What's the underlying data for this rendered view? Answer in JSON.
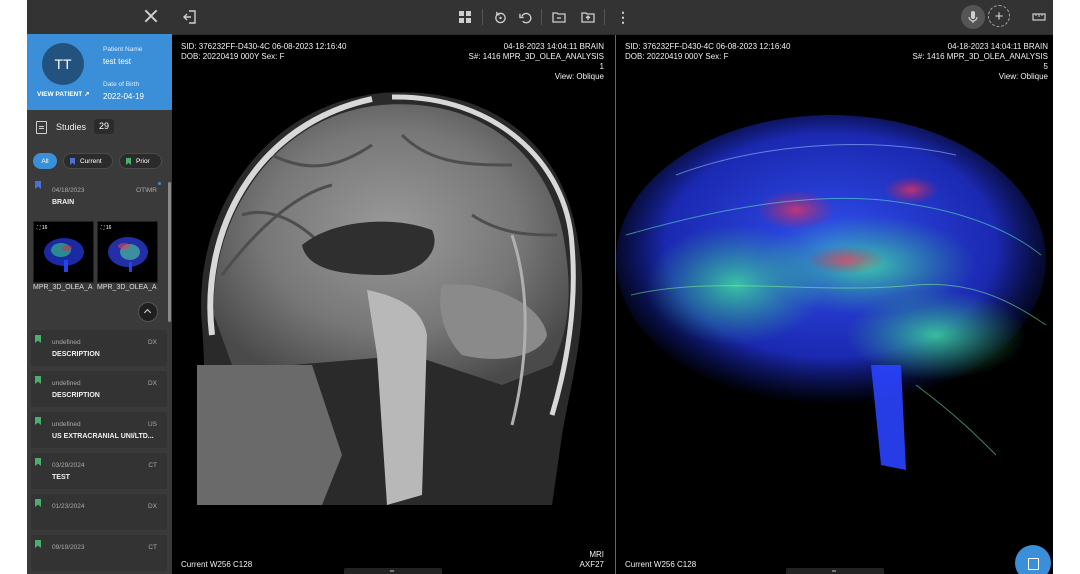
{
  "patient": {
    "initials": "TT",
    "view_patient": "VIEW PATIENT",
    "name_label": "Patient Name",
    "name": "test test",
    "dob_label": "Date of Birth",
    "dob": "2022-04-19"
  },
  "studies": {
    "label": "Studies",
    "count": "29",
    "filters": [
      "All",
      "Current",
      "Prior"
    ],
    "active_filter": "All",
    "expanded": {
      "date": "04/18/2023",
      "modality": "OT\\MR",
      "description": "BRAIN",
      "thumbnails": [
        {
          "label": "MPR_3D_OLEA_A",
          "badge": "16"
        },
        {
          "label": "MPR_3D_OLEA_A",
          "badge": "16"
        }
      ]
    },
    "items": [
      {
        "date": "undefined",
        "modality": "DX",
        "description": "DESCRIPTION"
      },
      {
        "date": "undefined",
        "modality": "DX",
        "description": "DESCRIPTION"
      },
      {
        "date": "undefined",
        "modality": "US",
        "description": "US EXTRACRANIAL UNI/LTD..."
      },
      {
        "date": "03/29/2024",
        "modality": "CT",
        "description": "TEST"
      },
      {
        "date": "01/23/2024",
        "modality": "DX",
        "description": ""
      },
      {
        "date": "09/19/2023",
        "modality": "CT",
        "description": ""
      }
    ]
  },
  "toolbar": {
    "icons": [
      "exit-icon",
      "layout-grid-icon",
      "reset-icon",
      "undo-icon",
      "folder-icon",
      "folder-export-icon",
      "more-vertical-icon",
      "microphone-icon",
      "add-icon",
      "ruler-icon"
    ]
  },
  "viewports": [
    {
      "sid": "SID: 376232FF-D430-4C  06-08-2023 12:16:40",
      "dob": "DOB: 20220419  000Y  Sex: F",
      "study_time": "04-18-2023 14:04:11  BRAIN",
      "series": "S#: 1416  MPR_3D_OLEA_ANALYSIS",
      "image_number": "1",
      "view": "View: Oblique",
      "wl": "Current  W256 C128",
      "modality": "MRI",
      "code": "AXF27"
    },
    {
      "sid": "SID: 376232FF-D430-4C  06-08-2023 12:16:40",
      "dob": "DOB: 20220419  000Y  Sex: F",
      "study_time": "04-18-2023 14:04:11  BRAIN",
      "series": "S#: 1416  MPR_3D_OLEA_ANALYSIS",
      "image_number": "5",
      "view": "View: Oblique",
      "wl": "Current  W256 C128"
    }
  ],
  "colors": {
    "accent": "#3a8fd8",
    "current_bookmark": "#4c6fd8",
    "prior_bookmark": "#4cae6c"
  }
}
